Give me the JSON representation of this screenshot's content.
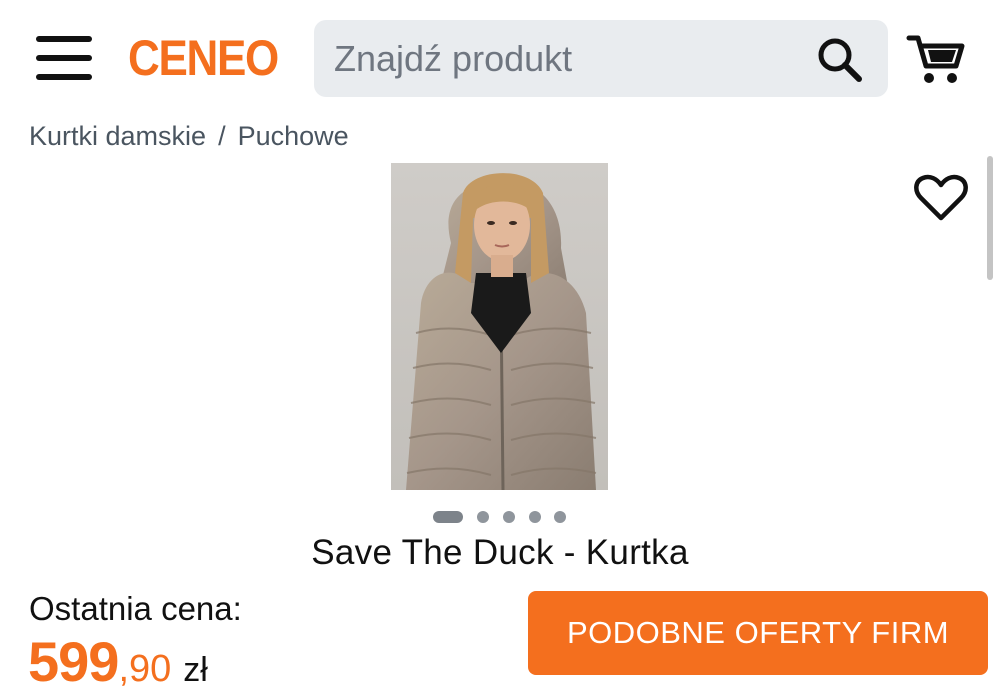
{
  "header": {
    "logo": "CENEO",
    "search": {
      "placeholder": "Znajdź produkt",
      "value": ""
    }
  },
  "breadcrumb": {
    "items": [
      "Kurtki damskie",
      "Puchowe"
    ],
    "separator": "/"
  },
  "product": {
    "title": "Save The Duck - Kurtka",
    "image_dots_count": 5,
    "active_dot": 0
  },
  "pricing": {
    "label": "Ostatnia cena:",
    "price_int": "599",
    "price_dec": ",90",
    "currency": "zł"
  },
  "cta": {
    "label": "PODOBNE OFERTY FIRM"
  },
  "colors": {
    "brand": "#f46f1e",
    "search_bg": "#e9ecef",
    "muted_text": "#4a5560"
  },
  "icons": [
    "menu-icon",
    "search-icon",
    "cart-icon",
    "heart-icon"
  ]
}
